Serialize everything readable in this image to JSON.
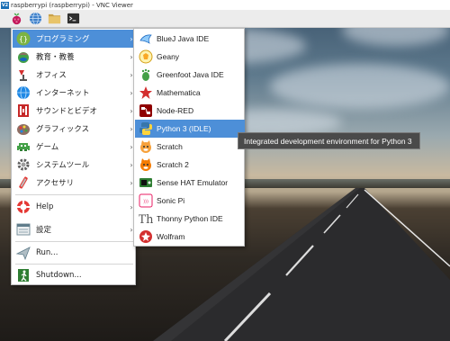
{
  "window": {
    "title": "raspberrypi (raspberrypi) - VNC Viewer",
    "logo_text": "V2"
  },
  "taskbar": {
    "buttons": [
      {
        "icon": "raspberry-icon"
      },
      {
        "icon": "globe-icon"
      },
      {
        "icon": "folder-icon"
      },
      {
        "icon": "terminal-icon"
      }
    ]
  },
  "main_menu": {
    "items": [
      {
        "label": "プログラミング",
        "icon": "programming-icon",
        "has_submenu": true,
        "active": true
      },
      {
        "label": "教育・教養",
        "icon": "education-icon",
        "has_submenu": true
      },
      {
        "label": "オフィス",
        "icon": "office-icon",
        "has_submenu": true
      },
      {
        "label": "インターネット",
        "icon": "internet-icon",
        "has_submenu": true
      },
      {
        "label": "サウンドとビデオ",
        "icon": "sound-video-icon",
        "has_submenu": true
      },
      {
        "label": "グラフィックス",
        "icon": "graphics-icon",
        "has_submenu": true
      },
      {
        "label": "ゲーム",
        "icon": "games-icon",
        "has_submenu": true
      },
      {
        "label": "システムツール",
        "icon": "system-tools-icon",
        "has_submenu": true
      },
      {
        "label": "アクセサリ",
        "icon": "accessories-icon",
        "has_submenu": true
      },
      {
        "label": "Help",
        "icon": "help-icon",
        "has_submenu": true
      },
      {
        "label": "設定",
        "icon": "settings-icon",
        "has_submenu": true
      },
      {
        "label": "Run...",
        "icon": "run-icon",
        "has_submenu": false
      },
      {
        "label": "Shutdown...",
        "icon": "shutdown-icon",
        "has_submenu": false
      }
    ],
    "arrow_glyph": "›"
  },
  "sub_menu": {
    "items": [
      {
        "label": "BlueJ Java IDE",
        "icon": "bluej-icon"
      },
      {
        "label": "Geany",
        "icon": "geany-icon"
      },
      {
        "label": "Greenfoot Java IDE",
        "icon": "greenfoot-icon"
      },
      {
        "label": "Mathematica",
        "icon": "mathematica-icon"
      },
      {
        "label": "Node-RED",
        "icon": "node-red-icon"
      },
      {
        "label": "Python 3 (IDLE)",
        "icon": "python-icon",
        "active": true
      },
      {
        "label": "Scratch",
        "icon": "scratch-icon"
      },
      {
        "label": "Scratch 2",
        "icon": "scratch2-icon"
      },
      {
        "label": "Sense HAT Emulator",
        "icon": "sense-hat-icon"
      },
      {
        "label": "Sonic Pi",
        "icon": "sonic-pi-icon"
      },
      {
        "label": "Thonny Python IDE",
        "icon": "thonny-icon"
      },
      {
        "label": "Wolfram",
        "icon": "wolfram-icon"
      }
    ]
  },
  "tooltip": {
    "text": "Integrated development environment for Python 3"
  },
  "colors": {
    "highlight": "#4d8fd8",
    "tooltip_bg": "#4a4a4a",
    "menu_bg": "#ffffff"
  }
}
